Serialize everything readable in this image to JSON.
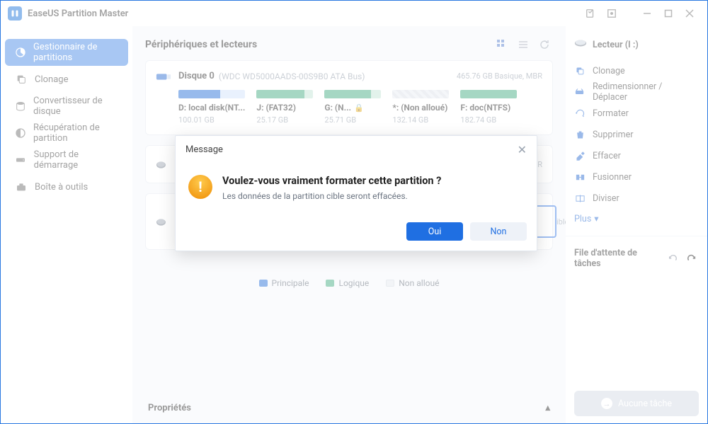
{
  "app": {
    "title": "EaseUS Partition Master"
  },
  "window_controls": {
    "task": "task-icon",
    "box": "box-icon",
    "min": "minimize",
    "max": "maximize",
    "close": "close"
  },
  "sidebar": {
    "items": [
      {
        "label": "Gestionnaire de partitions",
        "icon": "pie",
        "active": true
      },
      {
        "label": "Clonage",
        "icon": "copy",
        "active": false
      },
      {
        "label": "Convertisseur de disque",
        "icon": "disk",
        "active": false
      },
      {
        "label": "Récupération de partition",
        "icon": "pie-alt",
        "active": false
      },
      {
        "label": "Support de démarrage",
        "icon": "drive",
        "active": false
      },
      {
        "label": "Boîte à outils",
        "icon": "toolbox",
        "active": false
      }
    ]
  },
  "main": {
    "header": {
      "title": "Périphériques et lecteurs"
    },
    "disk0": {
      "title": "Disque 0",
      "subtitle": "(WDC WD5000AADS-00S9B0 ATA Bus)",
      "right": "465.76 GB Basique, MBR",
      "parts": [
        {
          "name": "D: local disk(NT...",
          "size": "100.01 GB",
          "type": "blue",
          "used_pct": 62,
          "lock": false
        },
        {
          "name": "J: (FAT32)",
          "size": "25.17 GB",
          "type": "green",
          "used_pct": 85,
          "lock": false
        },
        {
          "name": "G: (N...",
          "size": "25.71 GB",
          "type": "green",
          "used_pct": 82,
          "lock": true
        },
        {
          "name": "*: (Non alloué)",
          "size": "132.14 GB",
          "type": "unalloc",
          "used_pct": 0,
          "lock": false
        },
        {
          "name": "F: doc(NTFS)",
          "size": "182.74 GB",
          "type": "green",
          "used_pct": 100,
          "lock": false
        }
      ]
    },
    "disk1": {
      "right": "MBR"
    },
    "disk2": {
      "right": "ible"
    },
    "legend": {
      "a": "Principale",
      "b": "Logique",
      "c": "Non alloué"
    },
    "props": {
      "label": "Propriétés"
    }
  },
  "rightpanel": {
    "drive": "Lecteur (I :)",
    "ops": [
      {
        "label": "Clonage",
        "icon": "copy"
      },
      {
        "label": "Redimensionner / Déplacer",
        "icon": "resize"
      },
      {
        "label": "Formater",
        "icon": "format"
      },
      {
        "label": "Supprimer",
        "icon": "trash"
      },
      {
        "label": "Effacer",
        "icon": "erase"
      },
      {
        "label": "Fusionner",
        "icon": "merge"
      },
      {
        "label": "Diviser",
        "icon": "split"
      }
    ],
    "more": "Plus",
    "tasks": {
      "title": "File d'attente de tâches",
      "none": "Aucune tâche"
    }
  },
  "modal": {
    "title": "Message",
    "heading": "Voulez-vous vraiment formater cette partition ?",
    "body": "Les données de la partition cible seront effacées.",
    "yes": "Oui",
    "no": "Non"
  }
}
